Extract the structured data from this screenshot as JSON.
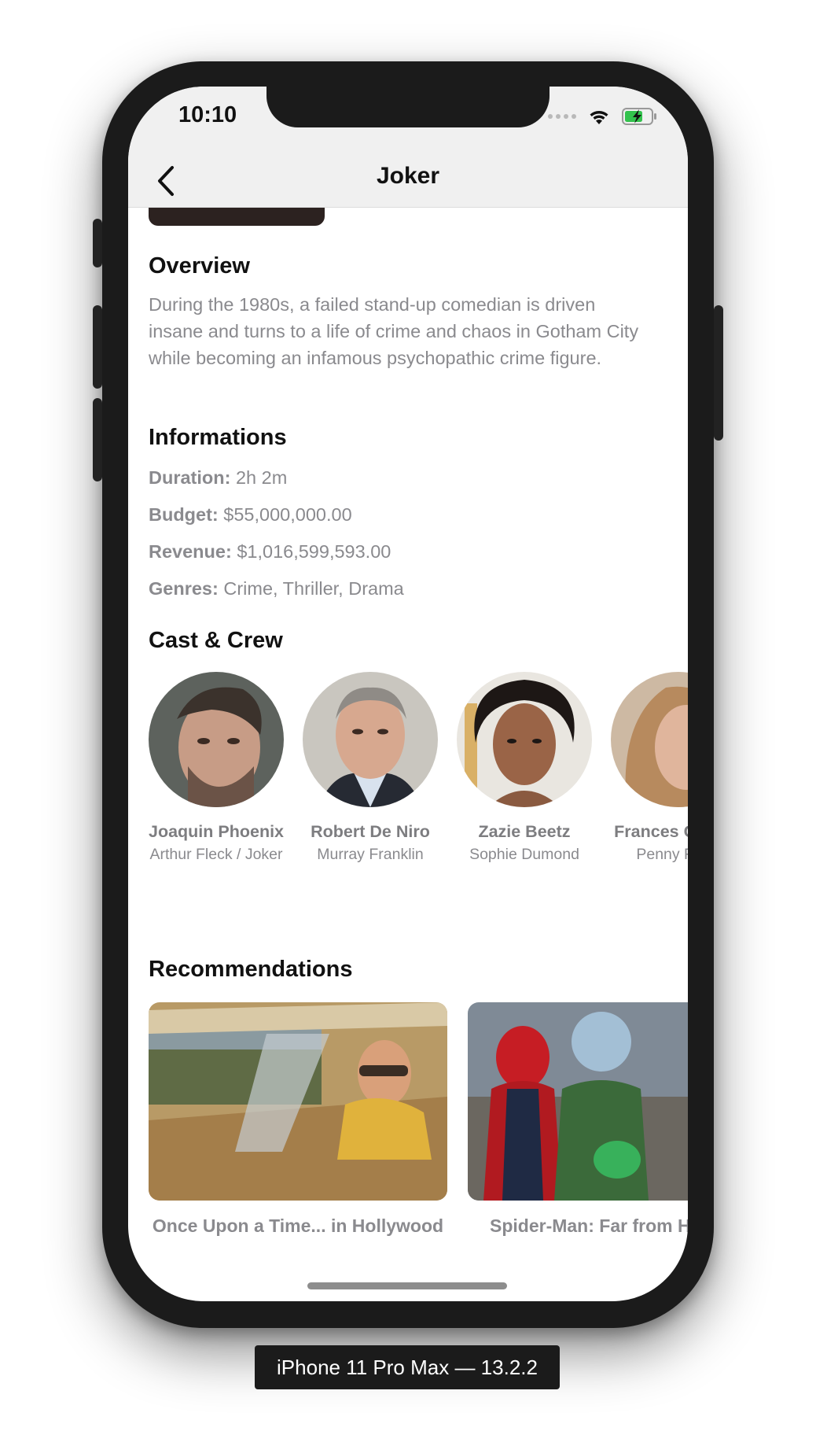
{
  "status_bar": {
    "time": "10:10"
  },
  "nav": {
    "title": "Joker",
    "back_icon": "chevron-left-icon"
  },
  "overview": {
    "heading": "Overview",
    "text": "During the 1980s, a failed stand-up comedian is driven insane and turns to a life of crime and chaos in Gotham City while becoming an infamous psychopathic crime figure."
  },
  "informations": {
    "heading": "Informations",
    "items": [
      {
        "label": "Duration:",
        "value": "2h 2m"
      },
      {
        "label": "Budget:",
        "value": "$55,000,000.00"
      },
      {
        "label": "Revenue:",
        "value": "$1,016,599,593.00"
      },
      {
        "label": "Genres:",
        "value": "Crime, Thriller, Drama"
      }
    ]
  },
  "cast": {
    "heading": "Cast & Crew",
    "members": [
      {
        "name": "Joaquin Phoenix",
        "role": "Arthur Fleck / Joker"
      },
      {
        "name": "Robert De Niro",
        "role": "Murray Franklin"
      },
      {
        "name": "Zazie Beetz",
        "role": "Sophie Dumond"
      },
      {
        "name": "Frances Conroy",
        "role": "Penny Fleck"
      }
    ]
  },
  "recommendations": {
    "heading": "Recommendations",
    "items": [
      {
        "title": "Once Upon a Time... in Hollywood"
      },
      {
        "title": "Spider-Man: Far from Home"
      }
    ]
  },
  "device_label": "iPhone 11 Pro Max — 13.2.2",
  "colors": {
    "text_primary": "#111111",
    "text_secondary": "#8a8a8e",
    "device_frame": "#1b1b1b",
    "header_bg": "#f0f0f0"
  }
}
